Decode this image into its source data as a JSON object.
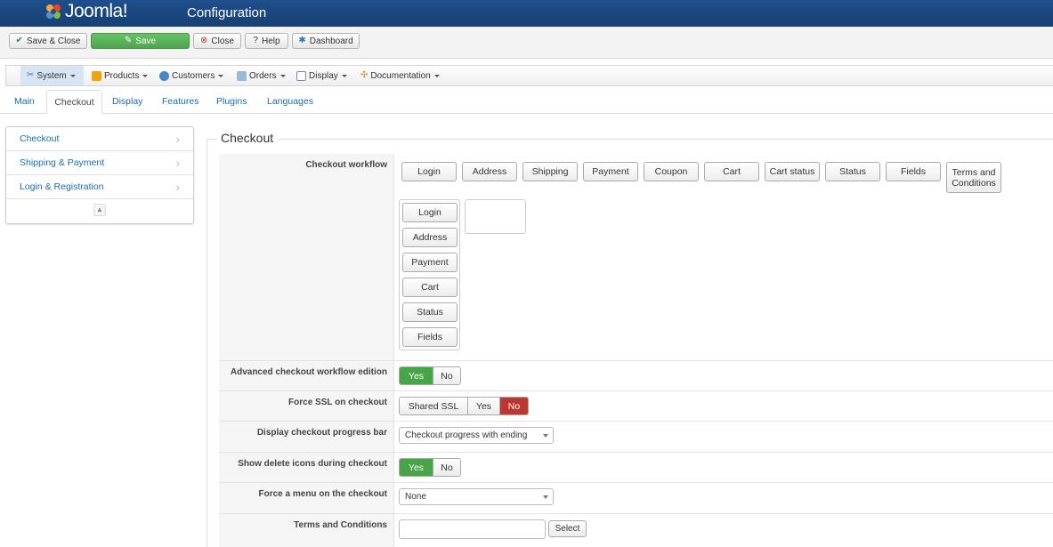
{
  "header": {
    "logo_text": "Joomla!",
    "page_title": "Configuration"
  },
  "toolbar": {
    "save_close": "Save & Close",
    "save": "Save",
    "close": "Close",
    "help": "Help",
    "dashboard": "Dashboard"
  },
  "menu": {
    "items": [
      {
        "label": "System",
        "icon": "wrench-icon"
      },
      {
        "label": "Products",
        "icon": "products-icon"
      },
      {
        "label": "Customers",
        "icon": "customers-icon"
      },
      {
        "label": "Orders",
        "icon": "orders-icon"
      },
      {
        "label": "Display",
        "icon": "display-icon"
      },
      {
        "label": "Documentation",
        "icon": "documentation-icon"
      }
    ]
  },
  "tabs": [
    "Main",
    "Checkout",
    "Display",
    "Features",
    "Plugins",
    "Languages"
  ],
  "sidebar": {
    "items": [
      "Checkout",
      "Shipping & Payment",
      "Login & Registration"
    ]
  },
  "fieldset": {
    "legend": "Checkout",
    "workflow_label": "Checkout workflow",
    "workflow_available": [
      "Login",
      "Address",
      "Shipping",
      "Payment",
      "Coupon",
      "Cart",
      "Cart status",
      "Status",
      "Fields",
      "Terms and Conditions"
    ],
    "workflow_steps": [
      "Login",
      "Address",
      "Payment",
      "Cart",
      "Status",
      "Fields"
    ],
    "advanced_label": "Advanced checkout workflow edition",
    "force_ssl_label": "Force SSL on checkout",
    "progress_label": "Display checkout progress bar",
    "progress_value": "Checkout progress with ending",
    "delete_icons_label": "Show delete icons during checkout",
    "force_menu_label": "Force a menu on the checkout",
    "force_menu_value": "None",
    "terms_label": "Terms and Conditions",
    "terms_select": "Select",
    "yes": "Yes",
    "no": "No",
    "shared_ssl": "Shared SSL"
  },
  "colors": {
    "header": "#1f4f8d",
    "green": "#46a546",
    "red": "#bd362f",
    "link": "#1a6cb3"
  }
}
